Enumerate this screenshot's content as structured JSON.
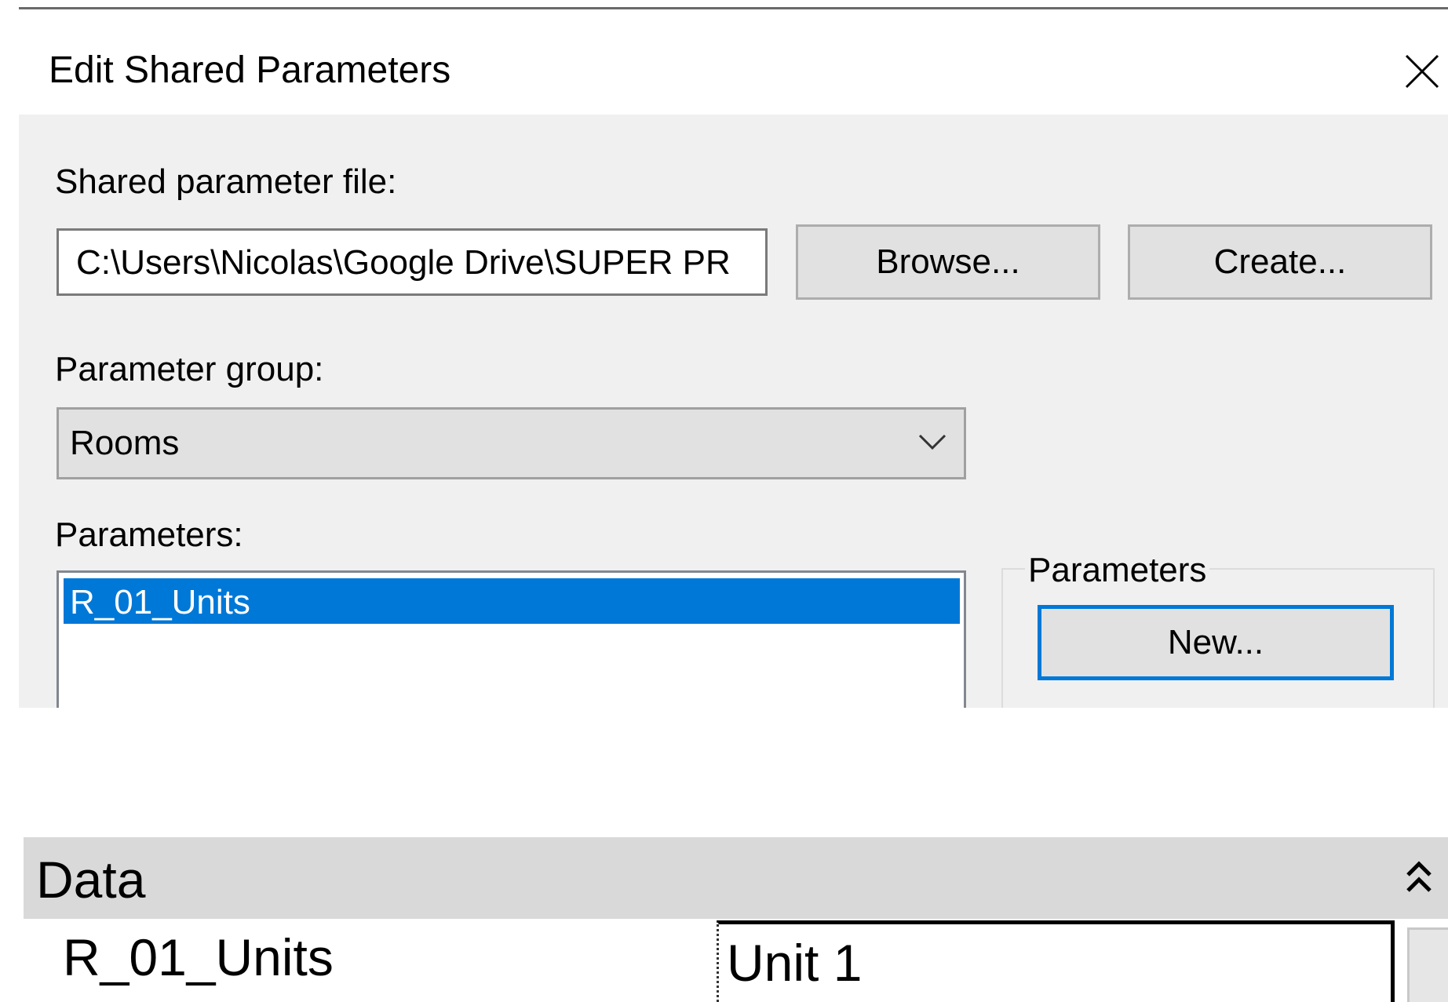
{
  "dialog": {
    "title": "Edit Shared Parameters",
    "file_label": "Shared parameter file:",
    "file_path": "C:\\Users\\Nicolas\\Google Drive\\SUPER PR",
    "browse_label": "Browse...",
    "create_label": "Create...",
    "group_label": "Parameter group:",
    "group_selected": "Rooms",
    "parameters_label": "Parameters:",
    "parameters_list": [
      "R_01_Units"
    ],
    "parameters_groupbox_title": "Parameters",
    "new_label": "New..."
  },
  "properties": {
    "section_title": "Data",
    "row_name": "R_01_Units",
    "row_value": "Unit 1"
  },
  "icons": {
    "close": "close-icon",
    "dropdown": "chevron-down-icon",
    "collapse": "double-chevron-up-icon"
  },
  "colors": {
    "selection": "#0078d7",
    "focus_border": "#0078d7",
    "dialog_background": "#f0f0f0",
    "button_face": "#e1e1e1",
    "section_header": "#d9d9d9"
  }
}
